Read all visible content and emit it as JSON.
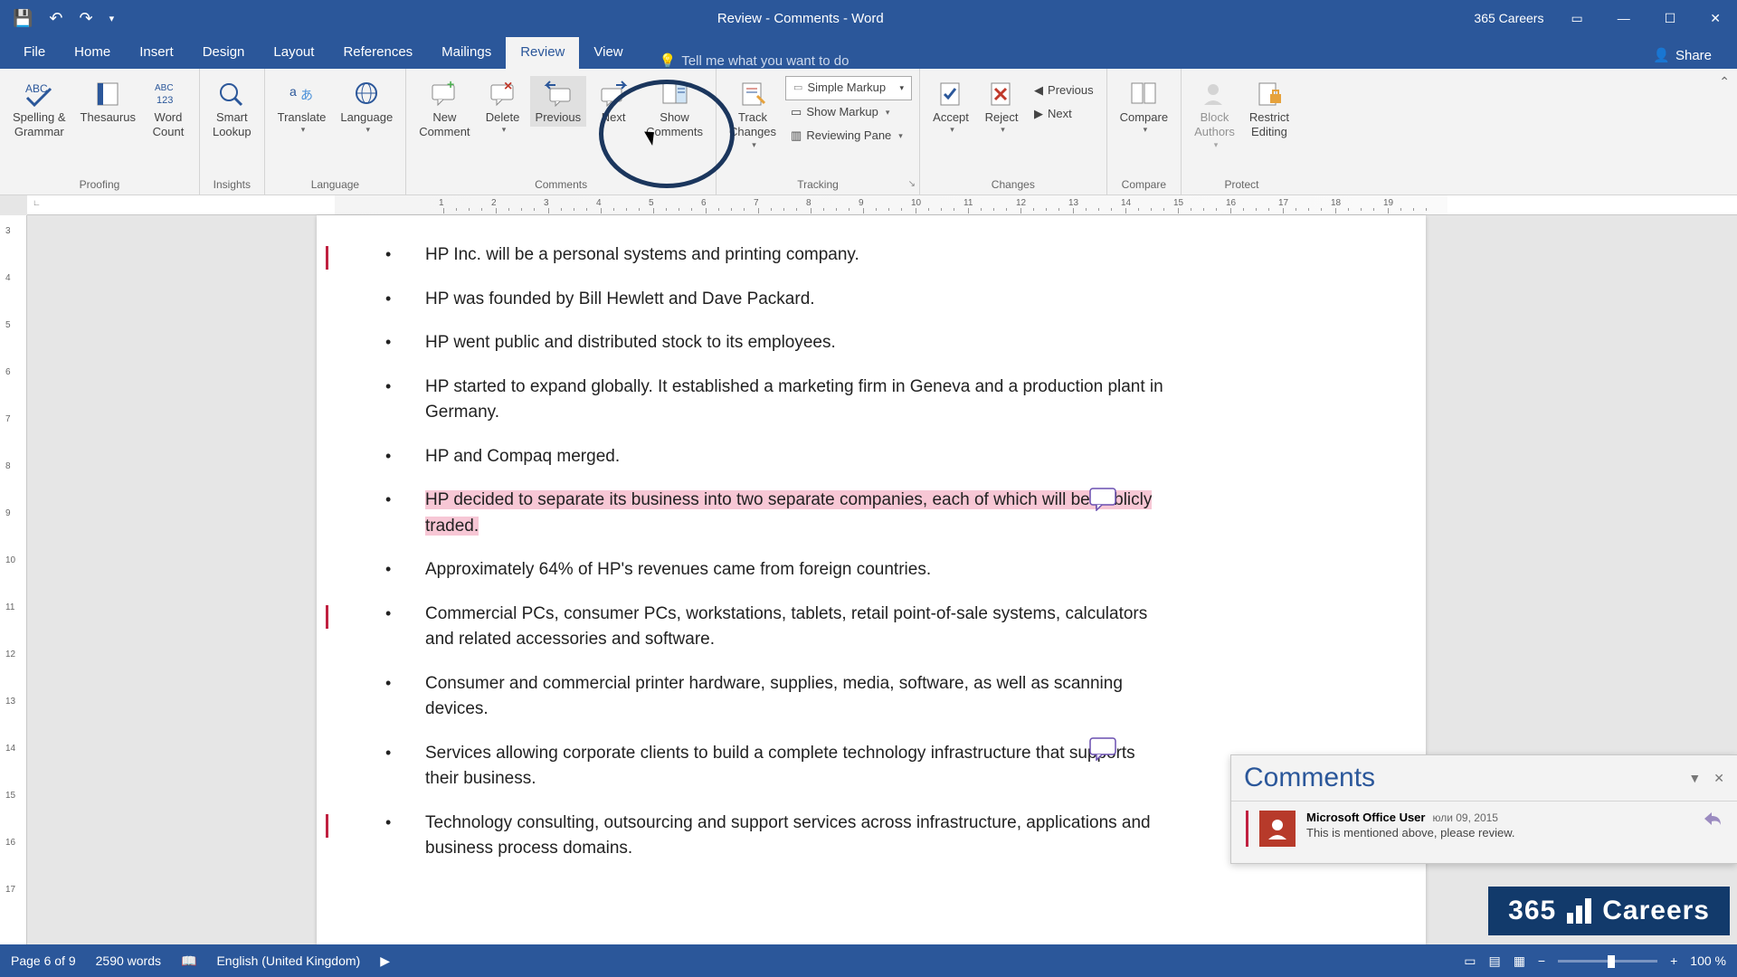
{
  "titlebar": {
    "title": "Review - Comments - Word",
    "account": "365 Careers"
  },
  "tabs": {
    "file": "File",
    "home": "Home",
    "insert": "Insert",
    "design": "Design",
    "layout": "Layout",
    "references": "References",
    "mailings": "Mailings",
    "review": "Review",
    "view": "View",
    "tellme": "Tell me what you want to do",
    "share": "Share"
  },
  "ribbon": {
    "proofing": {
      "label": "Proofing",
      "spelling": "Spelling &\nGrammar",
      "thesaurus": "Thesaurus",
      "wordcount": "Word\nCount"
    },
    "insights": {
      "label": "Insights",
      "smartlookup": "Smart\nLookup"
    },
    "language": {
      "label": "Language",
      "translate": "Translate",
      "language": "Language"
    },
    "comments": {
      "label": "Comments",
      "new": "New\nComment",
      "delete": "Delete",
      "previous": "Previous",
      "next": "Next",
      "show": "Show\nComments"
    },
    "tracking": {
      "label": "Tracking",
      "track": "Track\nChanges",
      "markup_combo": "Simple Markup",
      "show_markup": "Show Markup",
      "reviewing_pane": "Reviewing Pane"
    },
    "changes": {
      "label": "Changes",
      "accept": "Accept",
      "reject": "Reject",
      "previous": "Previous",
      "next": "Next"
    },
    "compare": {
      "label": "Compare",
      "compare": "Compare"
    },
    "protect": {
      "label": "Protect",
      "block": "Block\nAuthors",
      "restrict": "Restrict\nEditing"
    }
  },
  "document": {
    "bullets": [
      {
        "text": "HP Inc. will be a personal systems and printing company.",
        "mark": true
      },
      {
        "text": "HP was founded by Bill Hewlett and Dave Packard."
      },
      {
        "text": "HP went public and distributed stock to its employees."
      },
      {
        "text": "HP started to expand globally. It established a marketing firm in Geneva and a production plant in Germany."
      },
      {
        "text": "HP and Compaq merged."
      },
      {
        "text": "HP decided to separate its business into two separate companies, each of which will be publicly traded.",
        "highlight": true,
        "comment": true
      },
      {
        "text": "Approximately 64% of HP's revenues came from foreign countries."
      },
      {
        "text": "Commercial PCs, consumer PCs, workstations, tablets, retail point-of-sale systems, calculators and related accessories and software.",
        "mark": true
      },
      {
        "text": "Consumer and commercial printer hardware, supplies, media, software, as well as scanning devices."
      },
      {
        "text": "Services allowing corporate clients to build a complete technology infrastructure that supports their business.",
        "comment": true
      },
      {
        "text": "Technology consulting, outsourcing and support services across infrastructure, applications and business process domains.",
        "mark": true
      }
    ]
  },
  "comments_pane": {
    "title": "Comments",
    "user": "Microsoft Office User",
    "date": "юли 09, 2015",
    "message": "This is mentioned above, please review."
  },
  "statusbar": {
    "page": "Page 6 of 9",
    "words": "2590 words",
    "language": "English (United Kingdom)",
    "zoom": "100 %"
  },
  "ruler_h": [
    1,
    2,
    3,
    4,
    5,
    6,
    7,
    8,
    9,
    10,
    11,
    12,
    13,
    14,
    15,
    16,
    17,
    18,
    19
  ],
  "ruler_v": [
    3,
    4,
    5,
    6,
    7,
    8,
    9,
    10,
    11,
    12,
    13,
    14,
    15,
    16,
    17
  ],
  "brand": {
    "a": "365",
    "b": "Careers"
  }
}
